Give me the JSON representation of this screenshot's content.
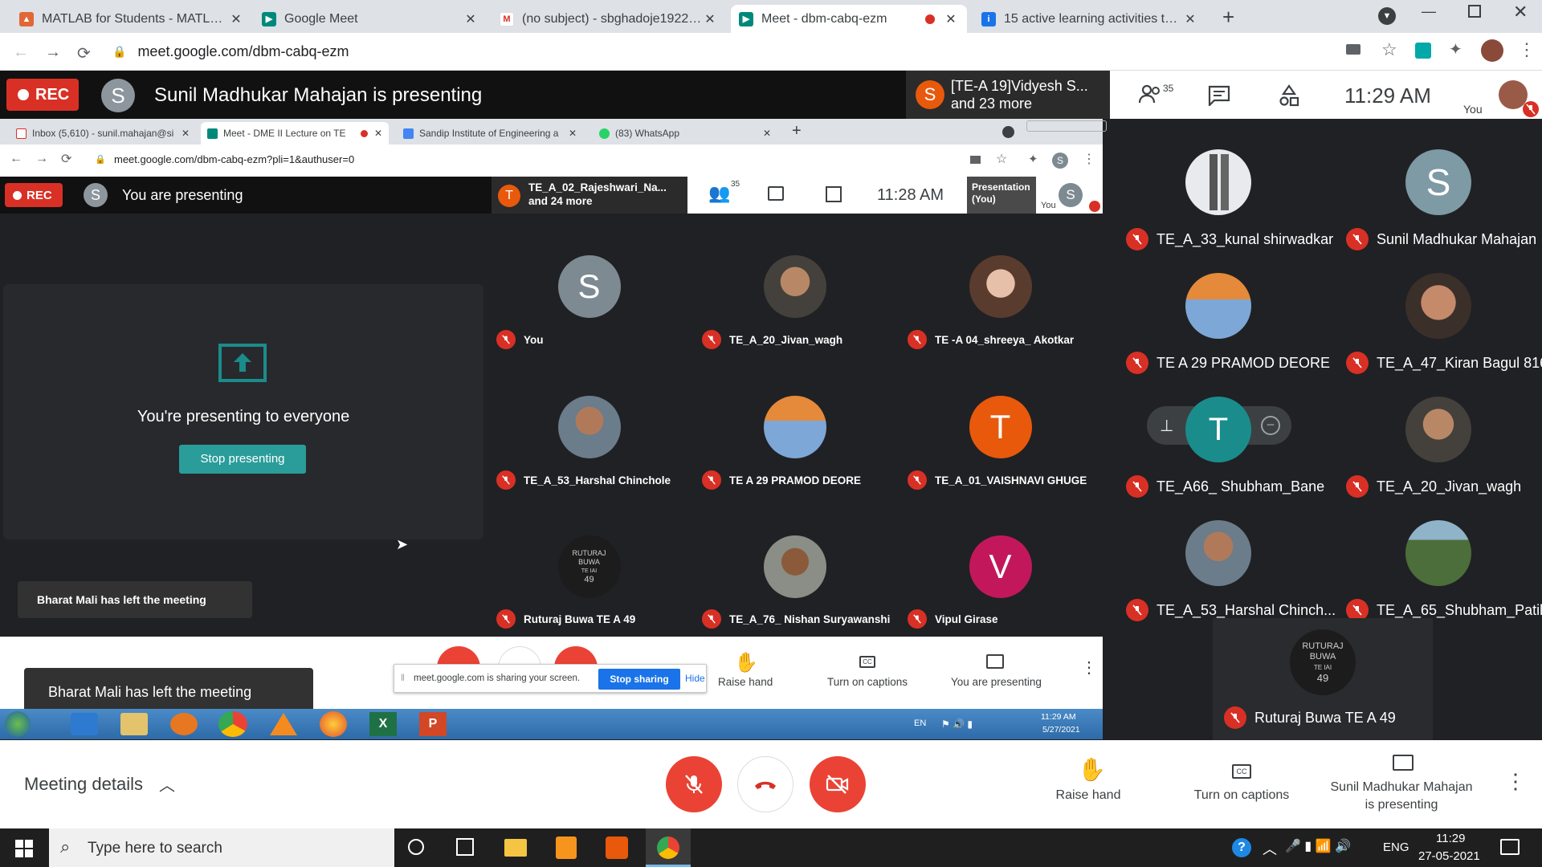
{
  "browser": {
    "tabs": [
      {
        "title": "MATLAB for Students - MATLAB & S"
      },
      {
        "title": "Google Meet"
      },
      {
        "title": "(no subject) - sbghadoje19221922"
      },
      {
        "title": "Meet - dbm-cabq-ezm"
      },
      {
        "title": "15 active learning activities to en"
      }
    ],
    "url": "meet.google.com/dbm-cabq-ezm"
  },
  "meet": {
    "rec_label": "REC",
    "presenter_avatar": "S",
    "presenting_text": "Sunil Madhukar Mahajan is presenting",
    "join_avatar": "S",
    "join_name": "[TE-A 19]Vidyesh S...",
    "join_more": "and 23 more",
    "participant_count": "35",
    "time": "11:29 AM",
    "you_label": "You",
    "tiles": [
      {
        "name": "TE_A_33_kunal shirwadkar"
      },
      {
        "name": "Sunil Madhukar Mahajan",
        "initial": "S"
      },
      {
        "name": "TE A 29 PRAMOD DEORE"
      },
      {
        "name": "TE_A_47_Kiran Bagul 816"
      },
      {
        "name": "TE_A66_ Shubham_Bane"
      },
      {
        "name": "TE_A_20_Jivan_wagh"
      },
      {
        "name": "TE_A_53_Harshal Chinch..."
      },
      {
        "name": "TE_A_65_Shubham_Patil"
      },
      {
        "name": "Ruturaj Buwa TE A 49",
        "badge_lines": [
          "RUTURAJ",
          "BUWA",
          "TE  IAI",
          "49"
        ]
      }
    ],
    "bottom": {
      "meeting_details": "Meeting details",
      "raise_hand": "Raise hand",
      "captions": "Turn on captions",
      "presenting_line1": "Sunil Madhukar Mahajan",
      "presenting_line2": "is presenting"
    }
  },
  "inner": {
    "tabs": [
      {
        "title": "Inbox (5,610) - sunil.mahajan@si"
      },
      {
        "title": "Meet - DME II Lecture on TE"
      },
      {
        "title": "Sandip Institute of Engineering a"
      },
      {
        "title": "(83) WhatsApp"
      }
    ],
    "url": "meet.google.com/dbm-cabq-ezm?pli=1&authuser=0",
    "rec_label": "REC",
    "presenter_avatar": "S",
    "presenting_text": "You are presenting",
    "join_avatar": "T",
    "join_name": "TE_A_02_Rajeshwari_Na...",
    "join_more": "and 24 more",
    "participant_count": "35",
    "time": "11:28 AM",
    "presentation_label": "Presentation",
    "presentation_you": "(You)",
    "you_avatar": "S",
    "you_label": "You",
    "presenting_everyone": "You're presenting to everyone",
    "stop_presenting": "Stop presenting",
    "left_toast": "Bharat Mali has left the meeting",
    "tiles": [
      {
        "name": "You",
        "initial": "S"
      },
      {
        "name": "TE_A_20_Jivan_wagh"
      },
      {
        "name": "TE -A 04_shreeya_ Akotkar"
      },
      {
        "name": "TE_A_53_Harshal Chinchole"
      },
      {
        "name": "TE A 29 PRAMOD DEORE"
      },
      {
        "name": "TE_A_01_VAISHNAVI GHUGE",
        "initial": "T"
      },
      {
        "name": "Ruturaj Buwa TE A 49",
        "badge_lines": [
          "RUTURAJ",
          "BUWA",
          "TE  IAI",
          "49"
        ]
      },
      {
        "name": "TE_A_76_ Nishan Suryawanshi"
      },
      {
        "name": "Vipul Girase",
        "initial": "V"
      }
    ],
    "sharing_text": "meet.google.com is sharing your screen.",
    "stop_sharing": "Stop sharing",
    "hide": "Hide",
    "raise_hand": "Raise hand",
    "captions": "Turn on captions",
    "you_presenting": "You are presenting",
    "tray_lang": "EN",
    "tray_time": "11:29 AM",
    "tray_date": "5/27/2021"
  },
  "toast": "Bharat Mali has left the meeting",
  "taskbar": {
    "search_placeholder": "Type here to search",
    "lang": "ENG",
    "time": "11:29",
    "date": "27-05-2021"
  },
  "colors": {
    "rec": "#d93025",
    "meet_teal": "#1a8c8c",
    "stop_btn": "#2a9d9a",
    "share_blue": "#1a73e8"
  }
}
